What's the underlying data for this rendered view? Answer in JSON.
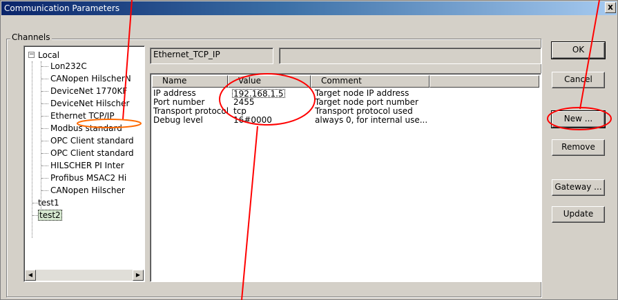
{
  "window": {
    "title": "Communication Parameters",
    "close_label": "x"
  },
  "channels": {
    "group_label": "Channels",
    "tree": [
      {
        "label": "Local",
        "expander": "−"
      },
      {
        "label": "Lon232C"
      },
      {
        "label": "CANopen HilscherN"
      },
      {
        "label": "DeviceNet 1770KF"
      },
      {
        "label": "DeviceNet Hilscher"
      },
      {
        "label": "Ethernet TCP/IP"
      },
      {
        "label": "Modbus standard"
      },
      {
        "label": "OPC Client standard"
      },
      {
        "label": "OPC Client standard"
      },
      {
        "label": "HILSCHER PI Inter"
      },
      {
        "label": "Profibus MSAC2 Hi"
      },
      {
        "label": "CANopen Hilscher"
      },
      {
        "label": "test1"
      },
      {
        "label": "test2"
      }
    ],
    "scroll_left": "◀",
    "scroll_right": "▶"
  },
  "detail": {
    "channel_name": "Ethernet_TCP_IP",
    "channel_comment": "",
    "columns": [
      "Name",
      "Value",
      "Comment"
    ],
    "rows": [
      {
        "name": "IP address",
        "value": "192.168.1.5",
        "comment": "Target node IP address"
      },
      {
        "name": "Port number",
        "value": "2455",
        "comment": "Target node port number"
      },
      {
        "name": "Transport protocol",
        "value": "tcp",
        "comment": "Transport protocol used"
      },
      {
        "name": "Debug level",
        "value": "16#0000",
        "comment": "always 0, for internal use..."
      }
    ]
  },
  "buttons": {
    "ok": "OK",
    "cancel": "Cancel",
    "new": "New ...",
    "remove": "Remove",
    "gateway": "Gateway ...",
    "update": "Update"
  },
  "colors": {
    "annotation": "#ff0000",
    "highlight_ring": "#ff6a00",
    "selection": "#d6e8d0"
  }
}
